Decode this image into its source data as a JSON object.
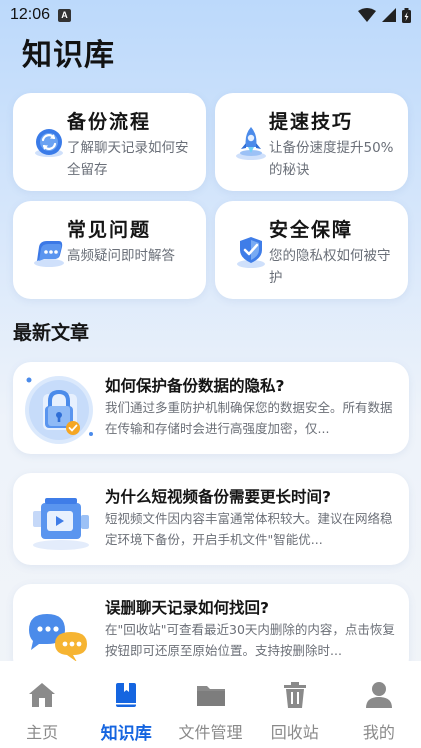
{
  "status_bar": {
    "time": "12:06",
    "notification_badge": "A",
    "icons": [
      "wifi-icon",
      "signal-icon",
      "battery-icon"
    ]
  },
  "page": {
    "title": "知识库"
  },
  "categories": [
    {
      "title": "备份流程",
      "desc": "了解聊天记录如何安全留存",
      "icon": "sync-icon"
    },
    {
      "title": "提速技巧",
      "desc": "让备份速度提升50%的秘诀",
      "icon": "rocket-icon"
    },
    {
      "title": "常见问题",
      "desc": "高频疑问即时解答",
      "icon": "chat-icon"
    },
    {
      "title": "安全保障",
      "desc": "您的隐私权如何被守护",
      "icon": "shield-icon"
    }
  ],
  "section": {
    "latest_title": "最新文章"
  },
  "articles": [
    {
      "title": "如何保护备份数据的隐私?",
      "desc": "我们通过多重防护机制确保您的数据安全。所有数据在传输和存储时会进行高强度加密，仅...",
      "icon": "lock-icon"
    },
    {
      "title": "为什么短视频备份需要更长时间?",
      "desc": "短视频文件因内容丰富通常体积较大。建议在网络稳定环境下备份，开启手机文件\"智能优...",
      "icon": "video-icon"
    },
    {
      "title": "误删聊天记录如何找回?",
      "desc": "在\"回收站\"可查看最近30天内删除的内容，点击恢复按钮即可还原至原始位置。支持按删除时...",
      "icon": "chat-bubbles-icon"
    }
  ],
  "nav": {
    "items": [
      {
        "label": "主页",
        "icon": "home-icon",
        "active": false
      },
      {
        "label": "知识库",
        "icon": "book-icon",
        "active": true
      },
      {
        "label": "文件管理",
        "icon": "folder-icon",
        "active": false
      },
      {
        "label": "回收站",
        "icon": "trash-icon",
        "active": false
      },
      {
        "label": "我的",
        "icon": "person-icon",
        "active": false
      }
    ]
  },
  "colors": {
    "accent": "#1565e0",
    "inactive": "#8a8a8a",
    "card_bg": "#ffffff"
  }
}
